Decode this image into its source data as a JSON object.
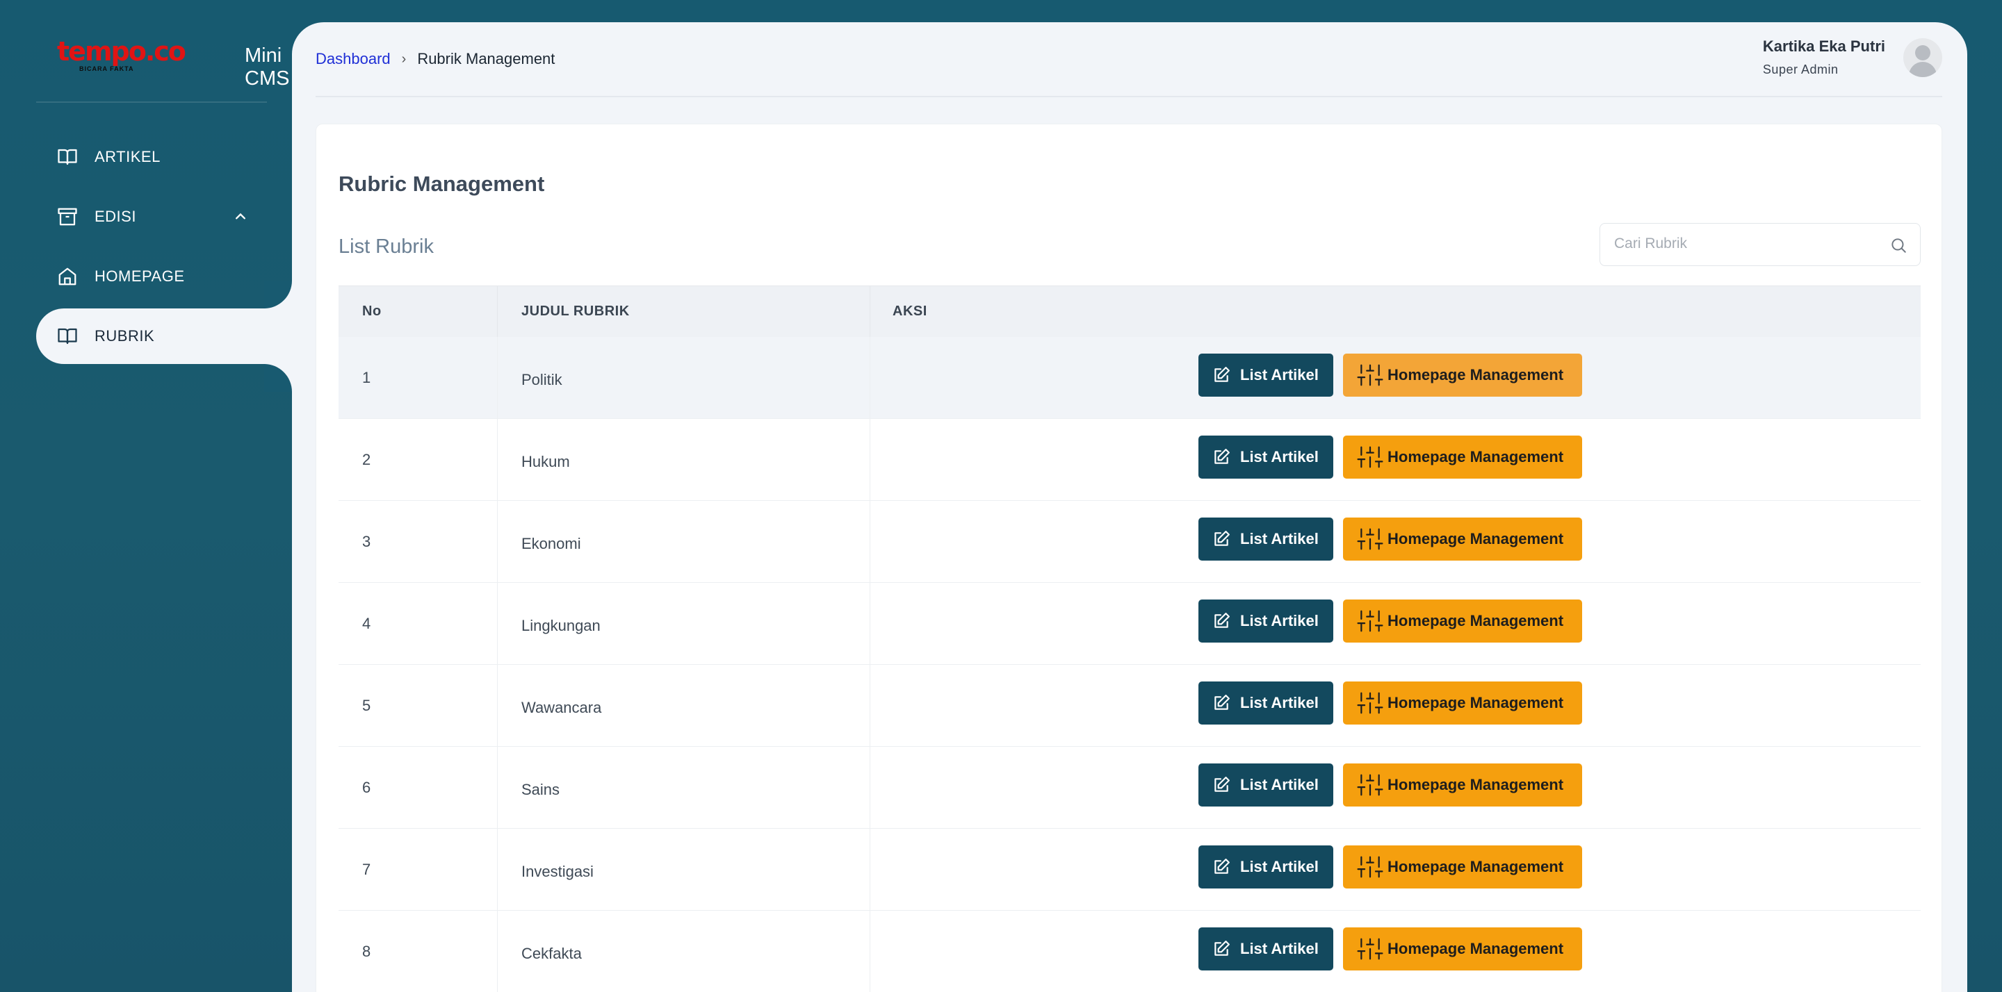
{
  "brand": {
    "logo_text": "tempo.co",
    "logo_tagline": "BICARA FAKTA",
    "app_name": "Mini CMS"
  },
  "sidebar": {
    "items": [
      {
        "label": "ARTIKEL",
        "icon": "book-open-icon"
      },
      {
        "label": "EDISI",
        "icon": "archive-icon",
        "expandable": true
      },
      {
        "label": "HOMEPAGE",
        "icon": "home-icon"
      },
      {
        "label": "RUBRIK",
        "icon": "book-open-icon",
        "active": true
      }
    ]
  },
  "header": {
    "breadcrumb": {
      "link": "Dashboard",
      "current": "Rubrik Management"
    },
    "user": {
      "name": "Kartika Eka Putri",
      "role": "Super Admin"
    }
  },
  "main": {
    "title": "Rubric Management",
    "list_title": "List Rubrik",
    "search": {
      "placeholder": "Cari Rubrik",
      "value": ""
    },
    "table": {
      "headers": [
        "No",
        "JUDUL RUBRIK",
        "AKSI"
      ],
      "rows": [
        {
          "no": "1",
          "judul": "Politik"
        },
        {
          "no": "2",
          "judul": "Hukum"
        },
        {
          "no": "3",
          "judul": "Ekonomi"
        },
        {
          "no": "4",
          "judul": "Lingkungan"
        },
        {
          "no": "5",
          "judul": "Wawancara"
        },
        {
          "no": "6",
          "judul": "Sains"
        },
        {
          "no": "7",
          "judul": "Investigasi"
        },
        {
          "no": "8",
          "judul": "Cekfakta"
        }
      ],
      "action_list_label": "List Artikel",
      "action_home_label": "Homepage Management"
    }
  },
  "colors": {
    "sidebar_bg": "#185a70",
    "content_bg": "#f2f5f9",
    "primary_button": "#13495e",
    "accent_button": "#f59f0e",
    "link": "#1f2fd6"
  }
}
